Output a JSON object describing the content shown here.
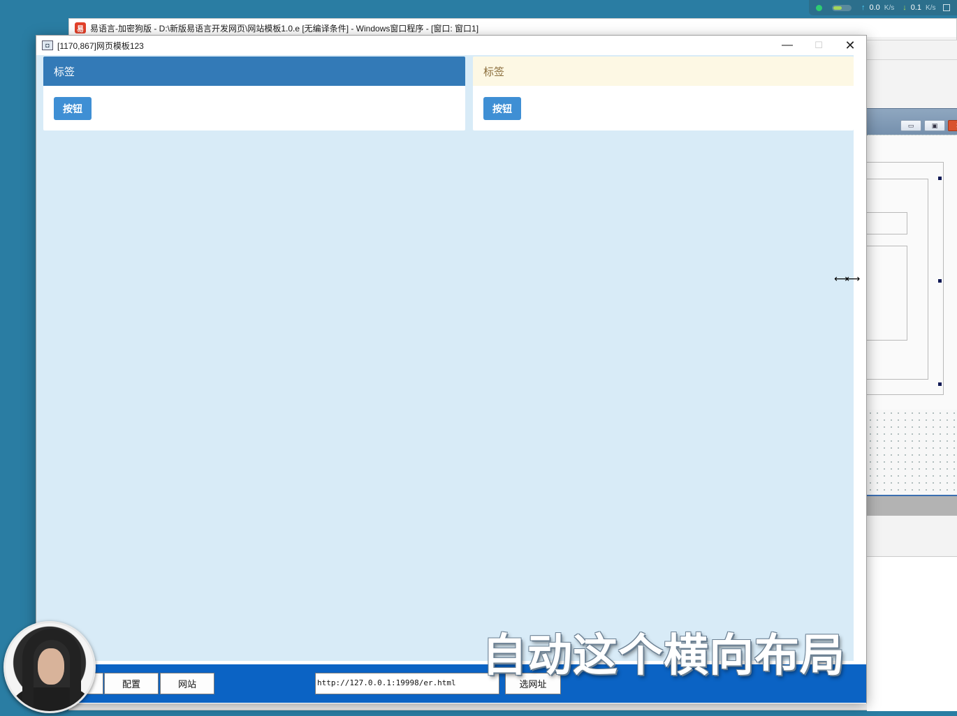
{
  "tray": {
    "upload_speed": "0.0",
    "upload_unit": "K/s",
    "download_speed": "0.1",
    "download_unit": "K/s"
  },
  "ide_window": {
    "title": "易语言-加密狗版 - D:\\新版易语言开发网页\\网站模板1.0.e [无编译条件] - Windows窗口程序 - [窗口: 窗口1]",
    "logo_icon": "easy-language-logo-icon"
  },
  "app_window": {
    "title": "[1170,867]网页模板123",
    "icon": "window-app-icon",
    "controls": {
      "minimize": "—",
      "maximize": "☐",
      "close": "✕"
    }
  },
  "web_page": {
    "background": "#d8ebf7",
    "cards": [
      {
        "heading": "标签",
        "button_label": "按钮",
        "style": "primary",
        "header_color": "#337ab7"
      },
      {
        "heading": "标签",
        "button_label": "按钮",
        "style": "warning",
        "header_color": "#fdf8e4"
      }
    ]
  },
  "bottom_bar": {
    "background": "#0b63c4",
    "buttons": [
      "配置",
      "网站"
    ],
    "url_value": "http://127.0.0.1:19998/er.html",
    "choose_url_button": "选网址"
  },
  "subtitle": "自动这个横向布局",
  "cursor": "horizontal-resize-icon",
  "webcam": "presenter-avatar"
}
